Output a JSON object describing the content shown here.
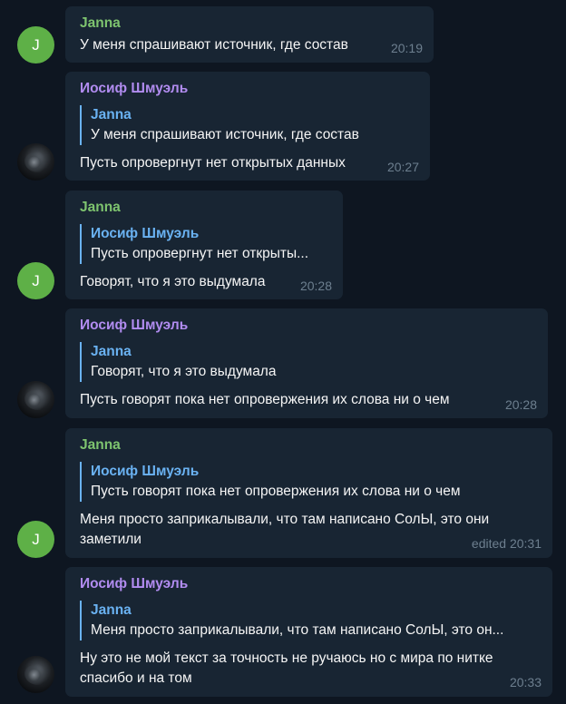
{
  "messages": [
    {
      "author": "Janna",
      "avatar_letter": "J",
      "text": "У меня спрашивают источник, где состав",
      "time": "20:19"
    },
    {
      "author": "Иосиф Шмуэль",
      "reply": {
        "author": "Janna",
        "text": "У меня спрашивают источник, где состав"
      },
      "text": "Пусть опровергнут нет открытых данных",
      "time": "20:27"
    },
    {
      "author": "Janna",
      "avatar_letter": "J",
      "reply": {
        "author": "Иосиф Шмуэль",
        "text": "Пусть опровергнут нет открыты..."
      },
      "text": "Говорят, что я это выдумала",
      "time": "20:28"
    },
    {
      "author": "Иосиф Шмуэль",
      "reply": {
        "author": "Janna",
        "text": "Говорят, что я это выдумала"
      },
      "text": "Пусть говорят пока нет опровержения их слова ни о чем",
      "time": "20:28"
    },
    {
      "author": "Janna",
      "avatar_letter": "J",
      "reply": {
        "author": "Иосиф Шмуэль",
        "text": "Пусть говорят пока нет опровержения их слова ни о чем"
      },
      "text_lines": [
        "Меня просто заприкалывали, что там написано СолЫ, это они",
        "заметили"
      ],
      "time": "edited 20:31"
    },
    {
      "author": "Иосиф Шмуэль",
      "reply": {
        "author": "Janna",
        "text": "Меня просто заприкалывали, что там написано СолЫ, это он..."
      },
      "text_lines": [
        "Ну это не мой текст за точность не ручаюсь но с мира по нитке",
        "спасибо и на том"
      ],
      "time": "20:33"
    }
  ],
  "colors": {
    "background": "#0e1621",
    "bubble": "#182533",
    "janna_name": "#7ec46f",
    "iosif_name": "#b18cf0",
    "reply_accent": "#6ab2f2",
    "time": "#6d7f8f",
    "avatar_green": "#5eb047"
  }
}
